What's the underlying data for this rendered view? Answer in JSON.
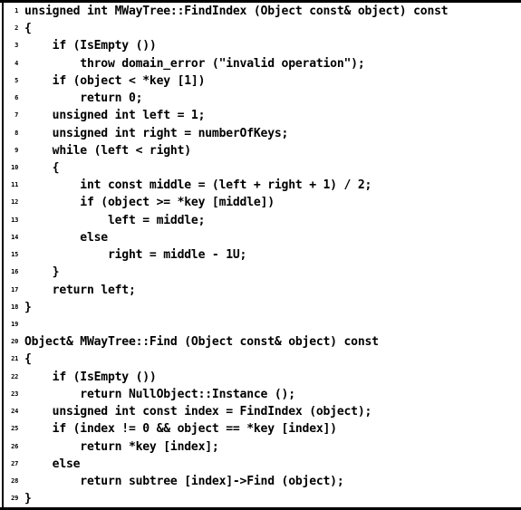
{
  "listing": {
    "language": "C++",
    "frame": {
      "top_rule": true,
      "bottom_rule": true,
      "left_rule": true,
      "right_rule": false
    },
    "colors": {
      "background": "#ffffff",
      "text": "#000000",
      "rule": "#000000"
    },
    "first_line_number": 1,
    "last_line_number": 29,
    "lines": [
      {
        "number": "1",
        "code": "unsigned int MWayTree::FindIndex (Object const& object) const"
      },
      {
        "number": "2",
        "code": "{"
      },
      {
        "number": "3",
        "code": "    if (IsEmpty ())"
      },
      {
        "number": "4",
        "code": "        throw domain_error (\"invalid operation\");"
      },
      {
        "number": "5",
        "code": "    if (object < *key [1])"
      },
      {
        "number": "6",
        "code": "        return 0;"
      },
      {
        "number": "7",
        "code": "    unsigned int left = 1;"
      },
      {
        "number": "8",
        "code": "    unsigned int right = numberOfKeys;"
      },
      {
        "number": "9",
        "code": "    while (left < right)"
      },
      {
        "number": "10",
        "code": "    {"
      },
      {
        "number": "11",
        "code": "        int const middle = (left + right + 1) / 2;"
      },
      {
        "number": "12",
        "code": "        if (object >= *key [middle])"
      },
      {
        "number": "13",
        "code": "            left = middle;"
      },
      {
        "number": "14",
        "code": "        else"
      },
      {
        "number": "15",
        "code": "            right = middle - 1U;"
      },
      {
        "number": "16",
        "code": "    }"
      },
      {
        "number": "17",
        "code": "    return left;"
      },
      {
        "number": "18",
        "code": "}"
      },
      {
        "number": "19",
        "code": ""
      },
      {
        "number": "20",
        "code": "Object& MWayTree::Find (Object const& object) const"
      },
      {
        "number": "21",
        "code": "{"
      },
      {
        "number": "22",
        "code": "    if (IsEmpty ())"
      },
      {
        "number": "23",
        "code": "        return NullObject::Instance ();"
      },
      {
        "number": "24",
        "code": "    unsigned int const index = FindIndex (object);"
      },
      {
        "number": "25",
        "code": "    if (index != 0 && object == *key [index])"
      },
      {
        "number": "26",
        "code": "        return *key [index];"
      },
      {
        "number": "27",
        "code": "    else"
      },
      {
        "number": "28",
        "code": "        return subtree [index]->Find (object);"
      },
      {
        "number": "29",
        "code": "}"
      }
    ]
  }
}
